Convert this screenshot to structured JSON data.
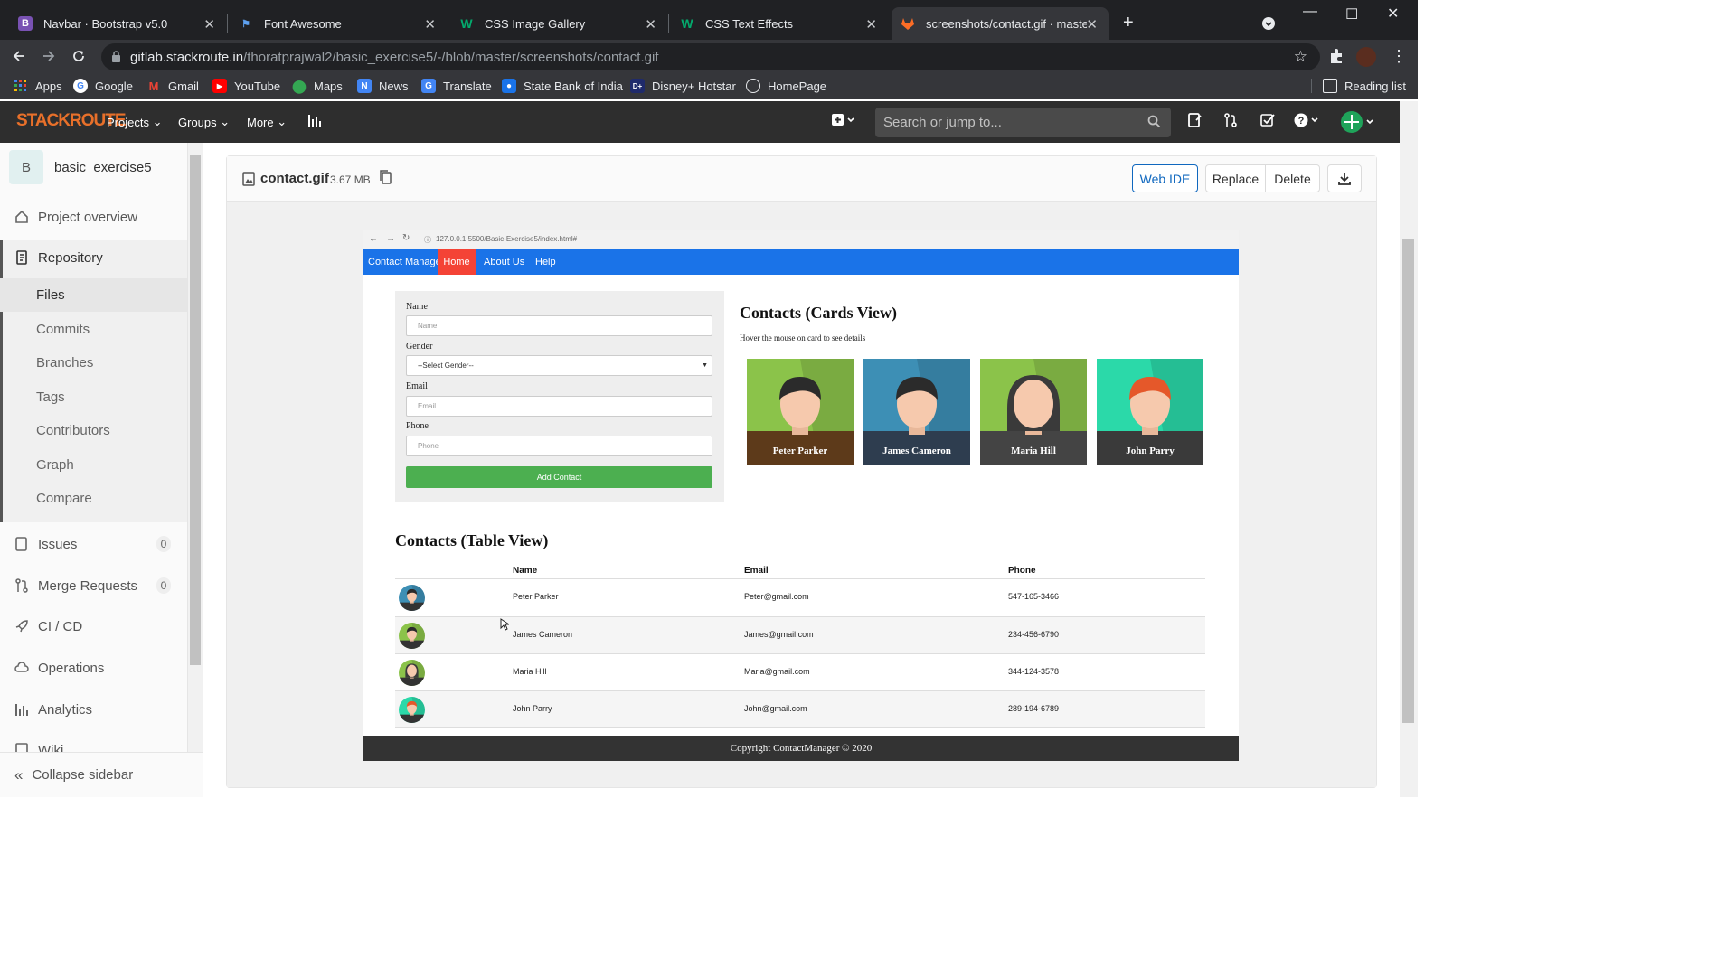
{
  "browser": {
    "tabs": [
      {
        "label": "Navbar · Bootstrap v5.0",
        "icon": "bootstrap-icon",
        "color": "#7952b3"
      },
      {
        "label": "Font Awesome",
        "icon": "flag-icon",
        "color": "#1c7ed6"
      },
      {
        "label": "CSS Image Gallery",
        "icon": "w3schools-icon",
        "color": "#04aa6d"
      },
      {
        "label": "CSS Text Effects",
        "icon": "w3schools-icon",
        "color": "#04aa6d"
      },
      {
        "label": "screenshots/contact.gif · master ·",
        "icon": "gitlab-icon",
        "color": "#fc6d26"
      }
    ],
    "url_host": "gitlab.stackroute.in",
    "url_path": "/thoratprajwal2/basic_exercise5/-/blob/master/screenshots/contact.gif",
    "bookmarks": [
      {
        "label": "Apps",
        "icon": "apps-icon",
        "color": "#4285f4"
      },
      {
        "label": "Google",
        "icon": "google-icon",
        "color": "#ffffff"
      },
      {
        "label": "Gmail",
        "icon": "gmail-icon",
        "color": "#ea4335"
      },
      {
        "label": "YouTube",
        "icon": "youtube-icon",
        "color": "#ff0000"
      },
      {
        "label": "Maps",
        "icon": "maps-icon",
        "color": "#34a853"
      },
      {
        "label": "News",
        "icon": "news-icon",
        "color": "#4285f4"
      },
      {
        "label": "Translate",
        "icon": "translate-icon",
        "color": "#4285f4"
      },
      {
        "label": "State Bank of India",
        "icon": "sbi-icon",
        "color": "#1a73e8"
      },
      {
        "label": "Disney+ Hotstar",
        "icon": "hotstar-icon",
        "color": "#1f2a6b"
      },
      {
        "label": "HomePage",
        "icon": "globe-icon",
        "color": "#9aa0a6"
      }
    ],
    "reading_list": "Reading list"
  },
  "gitlab": {
    "logo": "STACKROUTE",
    "nav": [
      "Projects",
      "Groups",
      "More"
    ],
    "search_placeholder": "Search or jump to..."
  },
  "sidebar": {
    "avatar_letter": "B",
    "project_name": "basic_exercise5",
    "items": [
      {
        "label": "Project overview",
        "icon": "home-icon"
      },
      {
        "label": "Repository",
        "icon": "doc-icon"
      },
      {
        "label": "Issues",
        "icon": "issues-icon",
        "badge": "0"
      },
      {
        "label": "Merge Requests",
        "icon": "merge-icon",
        "badge": "0"
      },
      {
        "label": "CI / CD",
        "icon": "rocket-icon"
      },
      {
        "label": "Operations",
        "icon": "cloud-icon"
      },
      {
        "label": "Analytics",
        "icon": "chart-icon"
      },
      {
        "label": "Wiki",
        "icon": "book-icon"
      }
    ],
    "repo_sub": [
      "Files",
      "Commits",
      "Branches",
      "Tags",
      "Contributors",
      "Graph",
      "Compare"
    ],
    "collapse": "Collapse sidebar"
  },
  "file": {
    "name": "contact.gif",
    "size": "3.67 MB",
    "buttons": {
      "webide": "Web IDE",
      "replace": "Replace",
      "delete": "Delete"
    }
  },
  "gif": {
    "url": "127.0.0.1:5500/Basic-Exercise5/index.html#",
    "nav": [
      "Contact Manager",
      "Home",
      "About Us",
      "Help"
    ],
    "form": {
      "name_label": "Name",
      "name_ph": "Name",
      "gender_label": "Gender",
      "gender_value": "--Select Gender--",
      "email_label": "Email",
      "email_ph": "Email",
      "phone_label": "Phone",
      "phone_ph": "Phone",
      "button": "Add Contact"
    },
    "cards_title": "Contacts (Cards View)",
    "cards_hint": "Hover the mouse on card to see details",
    "cards": [
      {
        "name": "Peter Parker",
        "bg": "#8bc34a",
        "hair": "#2b2b2b",
        "shirt": "#5d3a1a"
      },
      {
        "name": "James Cameron",
        "bg": "#3d8fb5",
        "hair": "#2b2b2b",
        "shirt": "#2e3d4f"
      },
      {
        "name": "Maria Hill",
        "bg": "#8bc34a",
        "hair": "#3a3a3a",
        "shirt": "#444444"
      },
      {
        "name": "John Parry",
        "bg": "#2bd9a9",
        "hair": "#e5582a",
        "shirt": "#3a3a3a"
      }
    ],
    "table_title": "Contacts (Table View)",
    "table_headers": [
      "Name",
      "Email",
      "Phone"
    ],
    "rows": [
      {
        "name": "Peter Parker",
        "email": "Peter@gmail.com",
        "phone": "547-165-3466",
        "bg": "#3d8fb5",
        "hair": "#2b2b2b"
      },
      {
        "name": "James Cameron",
        "email": "James@gmail.com",
        "phone": "234-456-6790",
        "bg": "#8bc34a",
        "hair": "#2b2b2b"
      },
      {
        "name": "Maria Hill",
        "email": "Maria@gmail.com",
        "phone": "344-124-3578",
        "bg": "#8bc34a",
        "hair": "#3a3a3a"
      },
      {
        "name": "John Parry",
        "email": "John@gmail.com",
        "phone": "289-194-6789",
        "bg": "#2bd9a9",
        "hair": "#e5582a"
      }
    ],
    "footer": "Copyright ContactManager © 2020"
  }
}
